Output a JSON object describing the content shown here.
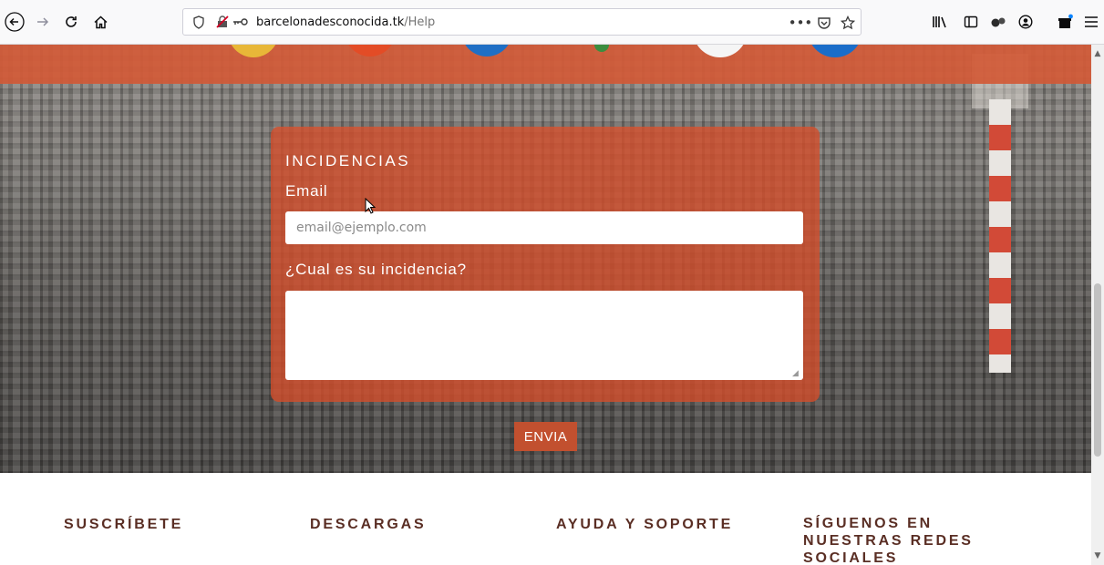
{
  "browser": {
    "url_domain": "barcelonadesconocida.tk",
    "url_path": "/Help",
    "icons": {
      "back": "back-arrow-icon",
      "forward": "forward-arrow-icon",
      "reload": "reload-icon",
      "home": "home-icon",
      "shield": "shield-icon",
      "insecure": "insecure-lock-icon",
      "key": "key-icon",
      "more": "more-icon",
      "pocket": "pocket-icon",
      "bookmark": "star-icon",
      "library": "library-icon",
      "sidebar": "sidebar-icon",
      "extension": "extension-icon",
      "account": "account-icon",
      "gift": "gift-icon",
      "menu": "hamburger-menu-icon"
    }
  },
  "form": {
    "title": "INCIDENCIAS",
    "email_label": "Email",
    "email_placeholder": "email@ejemplo.com",
    "message_label": "¿Cual es su incidencia?",
    "message_value": "",
    "submit_label": "ENVIA"
  },
  "footer": {
    "columns": [
      {
        "heading": "SUSCRÍBETE",
        "snippet": ""
      },
      {
        "heading": "DESCARGAS",
        "snippet": ""
      },
      {
        "heading": "AYUDA Y SOPORTE",
        "snippet": ""
      },
      {
        "heading": "SÍGUENOS EN NUESTRAS REDES SOCIALES",
        "snippet": ""
      }
    ]
  },
  "colors": {
    "accent": "#d34e2b",
    "footer_heading": "#5a2e24",
    "chrome_bg": "#f9f9fa"
  }
}
